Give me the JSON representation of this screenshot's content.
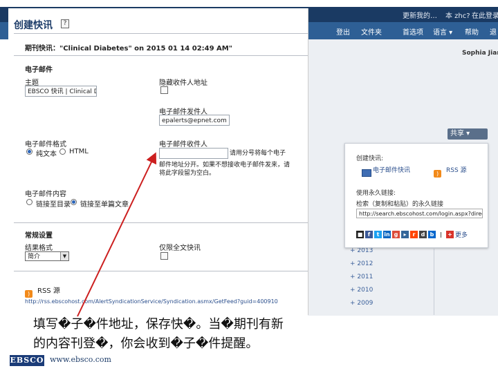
{
  "background_app": {
    "top_links": [
      "更新我的…",
      "本 zhc?",
      "在此登录"
    ],
    "nav_items": [
      "登出",
      "文件夹",
      "首选项",
      "语言 ▾",
      "帮助",
      "退"
    ],
    "user_name": "Sophia Jiang",
    "share_button": "共享 ▾",
    "sidebar_mark": "+",
    "years": [
      "+ 2013",
      "+ 2012",
      "+ 2011",
      "+ 2010",
      "+ 2009"
    ]
  },
  "popup": {
    "create_alert_label": "创建快讯:",
    "email_alert_link": "电子邮件快讯",
    "rss_feed_link": "RSS 源",
    "permalink_label": "使用永久链接:",
    "copy_permalink_text": "检索（复制和粘贴）的永久链接",
    "permalink_url": "http://search.ebscohost.com/login.aspx?direct",
    "share_more": "更多"
  },
  "dialog": {
    "title": "创建快讯",
    "help_symbol": "?",
    "alert_name": "期刊快讯：\"Clinical Diabetes\" on 2015 01 14 02:49 AM\"",
    "email_section": "电子邮件",
    "subject_label": "主题",
    "subject_value": "EBSCO 快讯 | Clinical Dia",
    "hide_recipients_label": "隐藏收件人地址",
    "from_label": "电子邮件发件人",
    "from_value": "epalerts@epnet.com",
    "format_label": "电子邮件格式",
    "format_plain": "纯文本",
    "format_html": "HTML",
    "to_label": "电子邮件收件人",
    "to_value": "",
    "to_hint_right": "请用分号将每个电子",
    "to_hint_below": "邮件地址分开。如果不想接收电子邮件发来，请将此字段留为空白。",
    "content_label": "电子邮件内容",
    "content_link_toc": "链接至目录",
    "content_link_articles": "链接至单篇文章",
    "general_section": "常规设置",
    "results_format_label": "结果格式",
    "results_format_value": "简介",
    "fulltext_only_label": "仅限全文快讯",
    "rss_label": "RSS 源",
    "rss_url": "http://rss.ebscohost.com/AlertSyndicationService/Syndication.asmx/GetFeed?guid=400910"
  },
  "caption": {
    "line1": "填写�子�件地址，保存快�。当�期刊有新",
    "line2": "的内容刊登�，你会收到�子�件提醒。"
  },
  "footer": {
    "logo": "EBSCO",
    "url": "www.ebsco.com"
  }
}
